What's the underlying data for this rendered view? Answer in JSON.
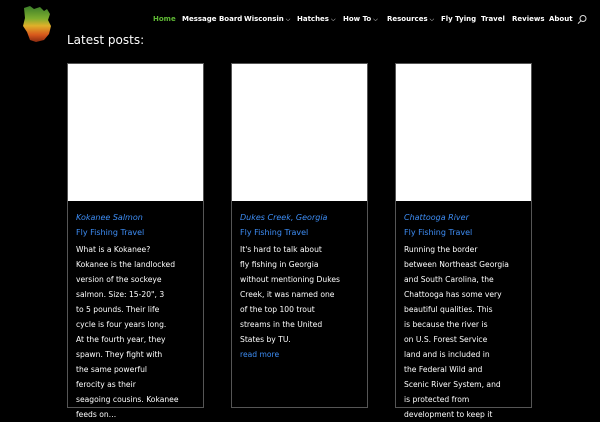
{
  "header": {
    "logo_icon": "wisconsin-state-logo-icon",
    "nav": [
      {
        "label": "Home",
        "active": true,
        "dropdown": false
      },
      {
        "label": "Message Board",
        "active": false,
        "dropdown": false
      },
      {
        "label": "Wisconsin",
        "active": false,
        "dropdown": true
      },
      {
        "label": "Hatches",
        "active": false,
        "dropdown": true
      },
      {
        "label": "How To",
        "active": false,
        "dropdown": true
      },
      {
        "label": "Resources",
        "active": false,
        "dropdown": true
      },
      {
        "label": "Fly Tying",
        "active": false,
        "dropdown": false
      },
      {
        "label": "Travel",
        "active": false,
        "dropdown": false
      },
      {
        "label": "Reviews",
        "active": false,
        "dropdown": false
      },
      {
        "label": "About",
        "active": false,
        "dropdown": false
      }
    ],
    "search_icon": "search-icon"
  },
  "section_title": "Latest posts:",
  "posts": [
    {
      "title": "Kokanee Salmon",
      "category": "Fly Fishing Travel",
      "excerpt": "What is a Kokanee?\nKokanee is the landlocked\nversion of the sockeye\nsalmon. Size: 15-20\", 3\nto 5 pounds. Their life\ncycle is four years long.\nAt the fourth year, they\nspawn. They fight with\nthe same powerful\nferocity as their\nseagoing cousins. Kokanee\nfeeds on…",
      "read_more": ""
    },
    {
      "title": "Dukes Creek, Georgia",
      "category": "Fly Fishing Travel",
      "excerpt": "It's hard to talk about\nfly fishing in Georgia\nwithout mentioning Dukes\nCreek, it was named one\nof the top 100 trout\nstreams in the United\nStates by TU.",
      "read_more": "read more"
    },
    {
      "title": "Chattooga River",
      "category": "Fly Fishing Travel",
      "excerpt": "Running the border\nbetween Northeast Georgia\nand South Carolina, the\nChattooga has some very\nbeautiful qualities.           This\nis because the river is\non U.S. Forest Service\nland and is included in\nthe Federal Wild and\nScenic River System, and\nis protected from\ndevelopment to keep it",
      "read_more": ""
    }
  ],
  "colors": {
    "background": "#000000",
    "nav_active": "#5fb934",
    "link": "#3d8df5",
    "card_border": "#555555",
    "thumbnail": "#ffffff"
  }
}
